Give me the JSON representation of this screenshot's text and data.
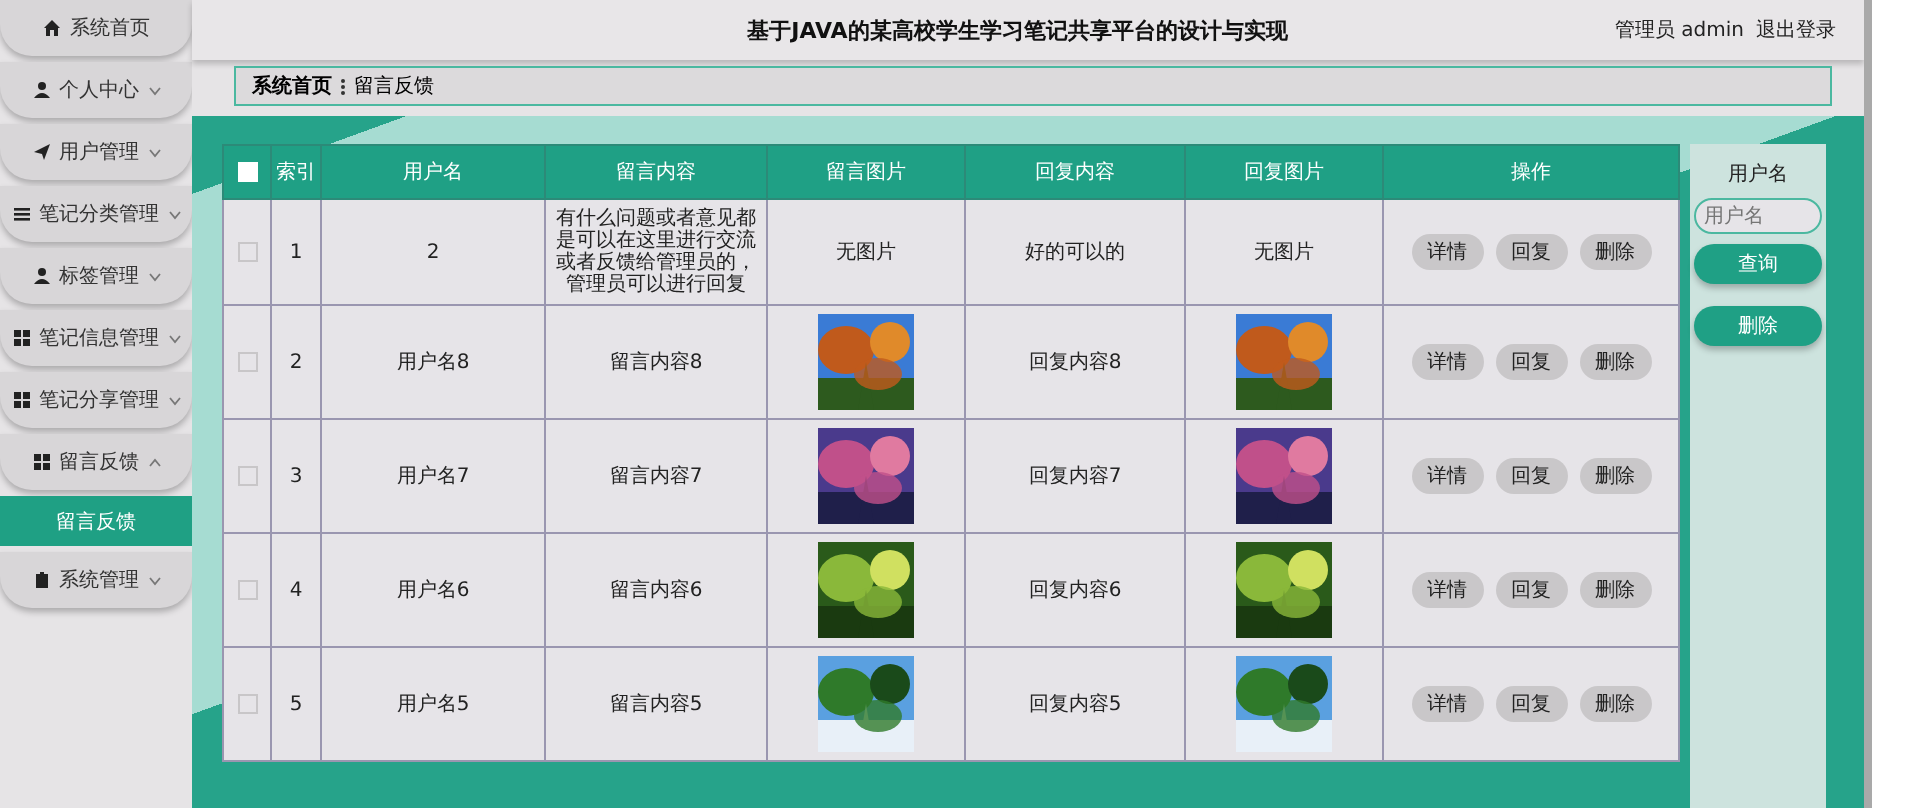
{
  "sidebar": {
    "items": [
      {
        "label": "系统首页",
        "kind": "link"
      },
      {
        "label": "个人中心",
        "kind": "group",
        "expanded": false
      },
      {
        "label": "用户管理",
        "kind": "group",
        "expanded": false
      },
      {
        "label": "笔记分类管理",
        "kind": "group",
        "expanded": false
      },
      {
        "label": "标签管理",
        "kind": "group",
        "expanded": false
      },
      {
        "label": "笔记信息管理",
        "kind": "group",
        "expanded": false
      },
      {
        "label": "笔记分享管理",
        "kind": "group",
        "expanded": false
      },
      {
        "label": "留言反馈",
        "kind": "group",
        "expanded": true,
        "children": [
          {
            "label": "留言反馈",
            "selected": true
          }
        ]
      },
      {
        "label": "系统管理",
        "kind": "group",
        "expanded": false
      }
    ]
  },
  "header": {
    "title": "基于JAVA的某高校学生学习笔记共享平台的设计与实现",
    "user": "管理员 admin",
    "logout": "退出登录"
  },
  "breadcrumb": [
    "系统首页",
    "留言反馈"
  ],
  "table": {
    "select_all": {
      "checked": false
    },
    "columns": [
      "索引",
      "用户名",
      "留言内容",
      "留言图片",
      "回复内容",
      "回复图片",
      "操作"
    ],
    "rows": [
      {
        "checked": false,
        "index": "1",
        "username": "2",
        "message": "有什么问题或者意见都是可以在这里进行交流或者反馈给管理员的，管理员可以进行回复",
        "message_image": {
          "kind": "text",
          "text": "无图片"
        },
        "reply": "好的可以的",
        "reply_image": {
          "kind": "text",
          "text": "无图片"
        },
        "actions": [
          "详情",
          "回复",
          "删除"
        ]
      },
      {
        "checked": false,
        "index": "2",
        "username": "用户名8",
        "message": "留言内容8",
        "message_image": {
          "kind": "picture"
        },
        "reply": "回复内容8",
        "reply_image": {
          "kind": "picture"
        },
        "actions": [
          "详情",
          "回复",
          "删除"
        ]
      },
      {
        "checked": false,
        "index": "3",
        "username": "用户名7",
        "message": "留言内容7",
        "message_image": {
          "kind": "picture"
        },
        "reply": "回复内容7",
        "reply_image": {
          "kind": "picture"
        },
        "actions": [
          "详情",
          "回复",
          "删除"
        ]
      },
      {
        "checked": false,
        "index": "4",
        "username": "用户名6",
        "message": "留言内容6",
        "message_image": {
          "kind": "picture"
        },
        "reply": "回复内容6",
        "reply_image": {
          "kind": "picture"
        },
        "actions": [
          "详情",
          "回复",
          "删除"
        ]
      },
      {
        "checked": false,
        "index": "5",
        "username": "用户名5",
        "message": "留言内容5",
        "message_image": {
          "kind": "picture"
        },
        "reply": "回复内容5",
        "reply_image": {
          "kind": "picture"
        },
        "actions": [
          "详情",
          "回复",
          "删除"
        ]
      }
    ]
  },
  "search": {
    "label": "用户名",
    "placeholder": "用户名",
    "search_button": "查询",
    "delete_button": "删除"
  }
}
